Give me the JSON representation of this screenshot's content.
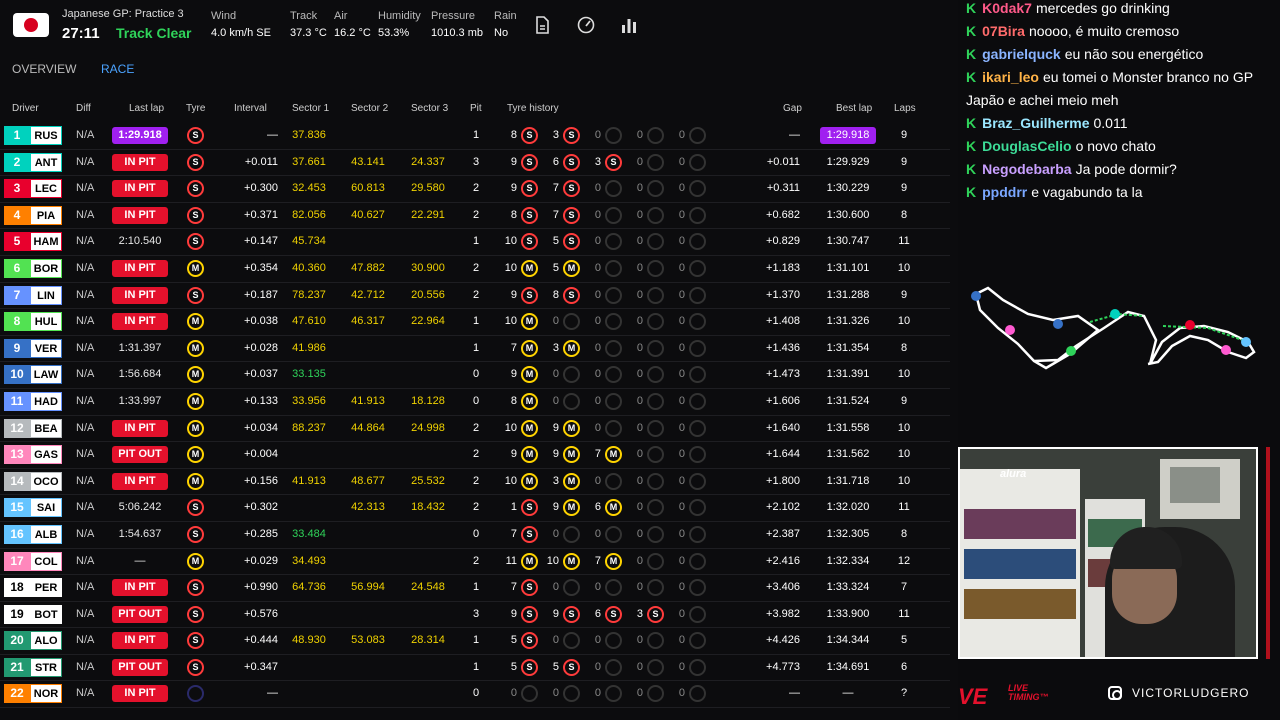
{
  "session": {
    "title": "Japanese GP: Practice 3",
    "clock": "27:11",
    "track_status": "Track Clear",
    "track_status_color": "#2fd35a"
  },
  "weather": [
    {
      "label": "Wind",
      "value": "4.0 km/h SE"
    },
    {
      "label": "Track",
      "value": "37.3 °C"
    },
    {
      "label": "Air",
      "value": "16.2 °C"
    },
    {
      "label": "Humidity",
      "value": "53.3%"
    },
    {
      "label": "Pressure",
      "value": "1010.3 mb"
    },
    {
      "label": "Rain",
      "value": "No"
    }
  ],
  "toolbar_icons": [
    "document-icon",
    "speedometer-icon",
    "bar-chart-icon"
  ],
  "tabs": [
    {
      "label": "OVERVIEW"
    },
    {
      "label": "RACE",
      "active": true
    }
  ],
  "columns": {
    "driver": "Driver",
    "diff": "Diff",
    "last": "Last lap",
    "tyre": "Tyre",
    "interval": "Interval",
    "s1": "Sector 1",
    "s2": "Sector 2",
    "s3": "Sector 3",
    "pit": "Pit",
    "history": "Tyre history",
    "gap": "Gap",
    "best": "Best lap",
    "laps": "Laps"
  },
  "rows": [
    {
      "pos": "1",
      "code": "RUS",
      "team": "#00d2be",
      "diff": "N/A",
      "last": "1:29.918",
      "last_style": "purple",
      "tyre": "S",
      "interval": "—",
      "s1": "37.836",
      "s1c": "sy",
      "s2": "",
      "s3": "",
      "pit": "1",
      "hist": [
        [
          "8",
          "S"
        ],
        [
          "3",
          "S"
        ],
        [
          "0",
          "E"
        ],
        [
          "0",
          "E"
        ],
        [
          "0",
          "E"
        ]
      ],
      "gap": "—",
      "best": "1:29.918",
      "best_purple": true,
      "laps": "9"
    },
    {
      "pos": "2",
      "code": "ANT",
      "team": "#00d2be",
      "diff": "N/A",
      "last": "IN PIT",
      "last_style": "inpit",
      "tyre": "S",
      "interval": "+0.011",
      "s1": "37.661",
      "s1c": "sy",
      "s2": "43.141",
      "s3": "24.337",
      "pit": "3",
      "hist": [
        [
          "9",
          "S"
        ],
        [
          "6",
          "S"
        ],
        [
          "3",
          "S"
        ],
        [
          "0",
          "E"
        ],
        [
          "0",
          "E"
        ]
      ],
      "gap": "+0.011",
      "best": "1:29.929",
      "laps": "9"
    },
    {
      "pos": "3",
      "code": "LEC",
      "team": "#e8002d",
      "diff": "N/A",
      "last": "IN PIT",
      "last_style": "inpit",
      "tyre": "S",
      "interval": "+0.300",
      "s1": "32.453",
      "s1c": "sy",
      "s2": "60.813",
      "s3": "29.580",
      "pit": "2",
      "hist": [
        [
          "9",
          "S"
        ],
        [
          "7",
          "S"
        ],
        [
          "0",
          "E"
        ],
        [
          "0",
          "E"
        ],
        [
          "0",
          "E"
        ]
      ],
      "gap": "+0.311",
      "best": "1:30.229",
      "laps": "9"
    },
    {
      "pos": "4",
      "code": "PIA",
      "team": "#ff8000",
      "diff": "N/A",
      "last": "IN PIT",
      "last_style": "inpit",
      "tyre": "S",
      "interval": "+0.371",
      "s1": "82.056",
      "s1c": "sy",
      "s2": "40.627",
      "s3": "22.291",
      "pit": "2",
      "hist": [
        [
          "8",
          "S"
        ],
        [
          "7",
          "S"
        ],
        [
          "0",
          "E"
        ],
        [
          "0",
          "E"
        ],
        [
          "0",
          "E"
        ]
      ],
      "gap": "+0.682",
      "best": "1:30.600",
      "laps": "8"
    },
    {
      "pos": "5",
      "code": "HAM",
      "team": "#e8002d",
      "diff": "N/A",
      "last": "2:10.540",
      "last_style": "",
      "tyre": "S",
      "interval": "+0.147",
      "s1": "45.734",
      "s1c": "sy",
      "s2": "",
      "s3": "",
      "pit": "1",
      "hist": [
        [
          "10",
          "S"
        ],
        [
          "5",
          "S"
        ],
        [
          "0",
          "E"
        ],
        [
          "0",
          "E"
        ],
        [
          "0",
          "E"
        ]
      ],
      "gap": "+0.829",
      "best": "1:30.747",
      "laps": "11"
    },
    {
      "pos": "6",
      "code": "BOR",
      "team": "#52e252",
      "diff": "N/A",
      "last": "IN PIT",
      "last_style": "inpit",
      "tyre": "M",
      "interval": "+0.354",
      "s1": "40.360",
      "s1c": "sy",
      "s2": "47.882",
      "s3": "30.900",
      "pit": "2",
      "hist": [
        [
          "10",
          "M"
        ],
        [
          "5",
          "M"
        ],
        [
          "0",
          "E"
        ],
        [
          "0",
          "E"
        ],
        [
          "0",
          "E"
        ]
      ],
      "gap": "+1.183",
      "best": "1:31.101",
      "laps": "10"
    },
    {
      "pos": "7",
      "code": "LIN",
      "team": "#6692ff",
      "diff": "N/A",
      "last": "IN PIT",
      "last_style": "inpit",
      "tyre": "S",
      "interval": "+0.187",
      "s1": "78.237",
      "s1c": "sy",
      "s2": "42.712",
      "s3": "20.556",
      "pit": "2",
      "hist": [
        [
          "9",
          "S"
        ],
        [
          "8",
          "S"
        ],
        [
          "0",
          "E"
        ],
        [
          "0",
          "E"
        ],
        [
          "0",
          "E"
        ]
      ],
      "gap": "+1.370",
      "best": "1:31.288",
      "laps": "9"
    },
    {
      "pos": "8",
      "code": "HUL",
      "team": "#52e252",
      "diff": "N/A",
      "last": "IN PIT",
      "last_style": "inpit",
      "tyre": "M",
      "interval": "+0.038",
      "s1": "47.610",
      "s1c": "sy",
      "s2": "46.317",
      "s3": "22.964",
      "pit": "1",
      "hist": [
        [
          "10",
          "M"
        ],
        [
          "0",
          "E"
        ],
        [
          "0",
          "E"
        ],
        [
          "0",
          "E"
        ],
        [
          "0",
          "E"
        ]
      ],
      "gap": "+1.408",
      "best": "1:31.326",
      "laps": "10"
    },
    {
      "pos": "9",
      "code": "VER",
      "team": "#3671c6",
      "diff": "N/A",
      "last": "1:31.397",
      "last_style": "",
      "tyre": "M",
      "interval": "+0.028",
      "s1": "41.986",
      "s1c": "sy",
      "s2": "",
      "s3": "",
      "pit": "1",
      "hist": [
        [
          "7",
          "M"
        ],
        [
          "3",
          "M"
        ],
        [
          "0",
          "E"
        ],
        [
          "0",
          "E"
        ],
        [
          "0",
          "E"
        ]
      ],
      "gap": "+1.436",
      "best": "1:31.354",
      "laps": "8"
    },
    {
      "pos": "10",
      "code": "LAW",
      "team": "#3671c6",
      "diff": "N/A",
      "last": "1:56.684",
      "last_style": "",
      "tyre": "M",
      "interval": "+0.037",
      "s1": "33.135",
      "s1c": "sg",
      "s2": "",
      "s3": "",
      "pit": "0",
      "hist": [
        [
          "9",
          "M"
        ],
        [
          "0",
          "E"
        ],
        [
          "0",
          "E"
        ],
        [
          "0",
          "E"
        ],
        [
          "0",
          "E"
        ]
      ],
      "gap": "+1.473",
      "best": "1:31.391",
      "laps": "10"
    },
    {
      "pos": "11",
      "code": "HAD",
      "team": "#6692ff",
      "diff": "N/A",
      "last": "1:33.997",
      "last_style": "",
      "tyre": "M",
      "interval": "+0.133",
      "s1": "33.956",
      "s1c": "sy",
      "s2": "41.913",
      "s3": "18.128",
      "pit": "0",
      "hist": [
        [
          "8",
          "M"
        ],
        [
          "0",
          "E"
        ],
        [
          "0",
          "E"
        ],
        [
          "0",
          "E"
        ],
        [
          "0",
          "E"
        ]
      ],
      "gap": "+1.606",
      "best": "1:31.524",
      "laps": "9"
    },
    {
      "pos": "12",
      "code": "BEA",
      "team": "#b6babd",
      "diff": "N/A",
      "last": "IN PIT",
      "last_style": "inpit",
      "tyre": "M",
      "interval": "+0.034",
      "s1": "88.237",
      "s1c": "sy",
      "s2": "44.864",
      "s3": "24.998",
      "pit": "2",
      "hist": [
        [
          "10",
          "M"
        ],
        [
          "9",
          "M"
        ],
        [
          "0",
          "E"
        ],
        [
          "0",
          "E"
        ],
        [
          "0",
          "E"
        ]
      ],
      "gap": "+1.640",
      "best": "1:31.558",
      "laps": "10"
    },
    {
      "pos": "13",
      "code": "GAS",
      "team": "#ff87bc",
      "diff": "N/A",
      "last": "PIT OUT",
      "last_style": "pitout",
      "tyre": "M",
      "interval": "+0.004",
      "s1": "",
      "s1c": "sy",
      "s2": "",
      "s3": "",
      "pit": "2",
      "hist": [
        [
          "9",
          "M"
        ],
        [
          "9",
          "M"
        ],
        [
          "7",
          "M"
        ],
        [
          "0",
          "E"
        ],
        [
          "0",
          "E"
        ]
      ],
      "gap": "+1.644",
      "best": "1:31.562",
      "laps": "10"
    },
    {
      "pos": "14",
      "code": "OCO",
      "team": "#b6babd",
      "diff": "N/A",
      "last": "IN PIT",
      "last_style": "inpit",
      "tyre": "M",
      "interval": "+0.156",
      "s1": "41.913",
      "s1c": "sy",
      "s2": "48.677",
      "s3": "25.532",
      "pit": "2",
      "hist": [
        [
          "10",
          "M"
        ],
        [
          "3",
          "M"
        ],
        [
          "0",
          "E"
        ],
        [
          "0",
          "E"
        ],
        [
          "0",
          "E"
        ]
      ],
      "gap": "+1.800",
      "best": "1:31.718",
      "laps": "10"
    },
    {
      "pos": "15",
      "code": "SAI",
      "team": "#64c4ff",
      "diff": "N/A",
      "last": "5:06.242",
      "last_style": "",
      "tyre": "S",
      "interval": "+0.302",
      "s1": "",
      "s1c": "sy",
      "s2": "42.313",
      "s3": "18.432",
      "pit": "2",
      "hist": [
        [
          "1",
          "S"
        ],
        [
          "9",
          "M"
        ],
        [
          "6",
          "M"
        ],
        [
          "0",
          "E"
        ],
        [
          "0",
          "E"
        ]
      ],
      "gap": "+2.102",
      "best": "1:32.020",
      "laps": "11"
    },
    {
      "pos": "16",
      "code": "ALB",
      "team": "#64c4ff",
      "diff": "N/A",
      "last": "1:54.637",
      "last_style": "",
      "tyre": "S",
      "interval": "+0.285",
      "s1": "33.484",
      "s1c": "sg",
      "s2": "",
      "s3": "",
      "pit": "0",
      "hist": [
        [
          "7",
          "S"
        ],
        [
          "0",
          "E"
        ],
        [
          "0",
          "E"
        ],
        [
          "0",
          "E"
        ],
        [
          "0",
          "E"
        ]
      ],
      "gap": "+2.387",
      "best": "1:32.305",
      "laps": "8"
    },
    {
      "pos": "17",
      "code": "COL",
      "team": "#ff87bc",
      "diff": "N/A",
      "last": "—",
      "last_style": "",
      "tyre": "M",
      "interval": "+0.029",
      "s1": "34.493",
      "s1c": "sy",
      "s2": "",
      "s3": "",
      "pit": "2",
      "hist": [
        [
          "11",
          "M"
        ],
        [
          "10",
          "M"
        ],
        [
          "7",
          "M"
        ],
        [
          "0",
          "E"
        ],
        [
          "0",
          "E"
        ]
      ],
      "gap": "+2.416",
      "best": "1:32.334",
      "laps": "12"
    },
    {
      "pos": "18",
      "code": "PER",
      "team": "#ffffff",
      "diff": "N/A",
      "last": "IN PIT",
      "last_style": "inpit",
      "tyre": "S",
      "interval": "+0.990",
      "s1": "64.736",
      "s1c": "sy",
      "s2": "56.994",
      "s3": "24.548",
      "pit": "1",
      "hist": [
        [
          "7",
          "S"
        ],
        [
          "0",
          "E"
        ],
        [
          "0",
          "E"
        ],
        [
          "0",
          "E"
        ],
        [
          "0",
          "E"
        ]
      ],
      "gap": "+3.406",
      "best": "1:33.324",
      "laps": "7"
    },
    {
      "pos": "19",
      "code": "BOT",
      "team": "#ffffff",
      "diff": "N/A",
      "last": "PIT OUT",
      "last_style": "pitout",
      "tyre": "S",
      "interval": "+0.576",
      "s1": "",
      "s1c": "sy",
      "s2": "",
      "s3": "",
      "pit": "3",
      "hist": [
        [
          "9",
          "S"
        ],
        [
          "9",
          "S"
        ],
        [
          "6",
          "S"
        ],
        [
          "3",
          "S"
        ],
        [
          "0",
          "E"
        ]
      ],
      "gap": "+3.982",
      "best": "1:33.900",
      "laps": "11"
    },
    {
      "pos": "20",
      "code": "ALO",
      "team": "#229971",
      "diff": "N/A",
      "last": "IN PIT",
      "last_style": "inpit",
      "tyre": "S",
      "interval": "+0.444",
      "s1": "48.930",
      "s1c": "sy",
      "s2": "53.083",
      "s3": "28.314",
      "pit": "1",
      "hist": [
        [
          "5",
          "S"
        ],
        [
          "0",
          "E"
        ],
        [
          "0",
          "E"
        ],
        [
          "0",
          "E"
        ],
        [
          "0",
          "E"
        ]
      ],
      "gap": "+4.426",
      "best": "1:34.344",
      "laps": "5"
    },
    {
      "pos": "21",
      "code": "STR",
      "team": "#229971",
      "diff": "N/A",
      "last": "PIT OUT",
      "last_style": "pitout",
      "tyre": "S",
      "interval": "+0.347",
      "s1": "",
      "s1c": "sy",
      "s2": "",
      "s3": "",
      "pit": "1",
      "hist": [
        [
          "5",
          "S"
        ],
        [
          "5",
          "S"
        ],
        [
          "0",
          "E"
        ],
        [
          "0",
          "E"
        ],
        [
          "0",
          "E"
        ]
      ],
      "gap": "+4.773",
      "best": "1:34.691",
      "laps": "6"
    },
    {
      "pos": "22",
      "code": "NOR",
      "team": "#ff8000",
      "diff": "N/A",
      "last": "IN PIT",
      "last_style": "inpit",
      "tyre": "E",
      "interval": "—",
      "s1": "",
      "s1c": "sy",
      "s2": "",
      "s3": "",
      "pit": "0",
      "hist": [
        [
          "0",
          "E"
        ],
        [
          "0",
          "E"
        ],
        [
          "0",
          "E"
        ],
        [
          "0",
          "E"
        ],
        [
          "0",
          "E"
        ]
      ],
      "gap": "—",
      "best": "—",
      "laps": "?"
    }
  ],
  "chat": [
    {
      "user": "K0dak7",
      "color": "#ff5a8a",
      "text": "mercedes go drinking"
    },
    {
      "user": "07Bira",
      "color": "#ff6b6b",
      "text": "noooo, é muito cremoso"
    },
    {
      "user": "gabrielquck",
      "color": "#8ab4ff",
      "text": "eu não sou energético"
    },
    {
      "user": "ikari_leo",
      "color": "#ffb347",
      "text": "eu tomei o Monster branco no GP Japão e achei meio meh",
      "wrap": true
    },
    {
      "user": "Braz_Guilherme",
      "color": "#9be7ff",
      "text": "0.011"
    },
    {
      "user": "DouglasCelio",
      "color": "#3ddc97",
      "text": "o novo chato"
    },
    {
      "user": "Negodebarba",
      "color": "#c9a0ff",
      "text": "Ja pode dormir?"
    },
    {
      "user": "ppddrr",
      "color": "#7aa7ff",
      "text": "e vagabundo ta la"
    }
  ],
  "cam_overlay": "alura",
  "brand": {
    "line1": "LIVE",
    "line2": "TIMING™",
    "handle": "VICTORLUDGERO"
  }
}
